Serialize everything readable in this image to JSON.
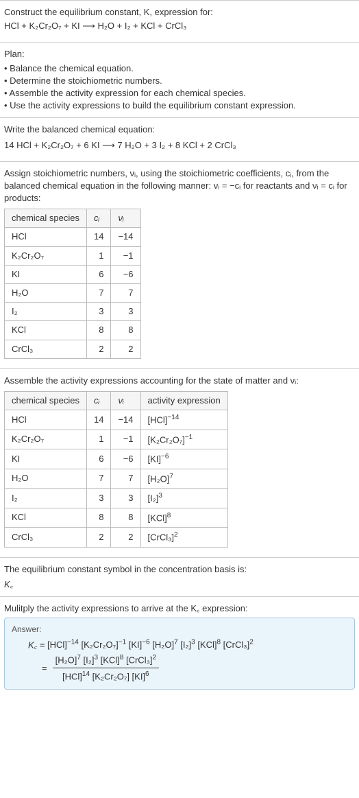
{
  "intro": {
    "line1": "Construct the equilibrium constant, K, expression for:",
    "equation": "HCl + K₂Cr₂O₇ + KI ⟶ H₂O + I₂ + KCl + CrCl₃"
  },
  "plan": {
    "header": "Plan:",
    "items": [
      "• Balance the chemical equation.",
      "• Determine the stoichiometric numbers.",
      "• Assemble the activity expression for each chemical species.",
      "• Use the activity expressions to build the equilibrium constant expression."
    ]
  },
  "balanced": {
    "label": "Write the balanced chemical equation:",
    "equation": "14 HCl + K₂Cr₂O₇ + 6 KI ⟶ 7 H₂O + 3 I₂ + 8 KCl + 2 CrCl₃"
  },
  "stoich": {
    "text": "Assign stoichiometric numbers, νᵢ, using the stoichiometric coefficients, cᵢ, from the balanced chemical equation in the following manner: νᵢ = −cᵢ for reactants and νᵢ = cᵢ for products:",
    "headers": [
      "chemical species",
      "cᵢ",
      "νᵢ"
    ],
    "rows": [
      {
        "sp": "HCl",
        "c": "14",
        "n": "−14"
      },
      {
        "sp": "K₂Cr₂O₇",
        "c": "1",
        "n": "−1"
      },
      {
        "sp": "KI",
        "c": "6",
        "n": "−6"
      },
      {
        "sp": "H₂O",
        "c": "7",
        "n": "7"
      },
      {
        "sp": "I₂",
        "c": "3",
        "n": "3"
      },
      {
        "sp": "KCl",
        "c": "8",
        "n": "8"
      },
      {
        "sp": "CrCl₃",
        "c": "2",
        "n": "2"
      }
    ]
  },
  "activity": {
    "text": "Assemble the activity expressions accounting for the state of matter and νᵢ:",
    "headers": [
      "chemical species",
      "cᵢ",
      "νᵢ",
      "activity expression"
    ],
    "rows": [
      {
        "sp": "HCl",
        "c": "14",
        "n": "−14",
        "a_base": "[HCl]",
        "a_exp": "−14"
      },
      {
        "sp": "K₂Cr₂O₇",
        "c": "1",
        "n": "−1",
        "a_base": "[K₂Cr₂O₇]",
        "a_exp": "−1"
      },
      {
        "sp": "KI",
        "c": "6",
        "n": "−6",
        "a_base": "[KI]",
        "a_exp": "−6"
      },
      {
        "sp": "H₂O",
        "c": "7",
        "n": "7",
        "a_base": "[H₂O]",
        "a_exp": "7"
      },
      {
        "sp": "I₂",
        "c": "3",
        "n": "3",
        "a_base": "[I₂]",
        "a_exp": "3"
      },
      {
        "sp": "KCl",
        "c": "8",
        "n": "8",
        "a_base": "[KCl]",
        "a_exp": "8"
      },
      {
        "sp": "CrCl₃",
        "c": "2",
        "n": "2",
        "a_base": "[CrCl₃]",
        "a_exp": "2"
      }
    ]
  },
  "conc_basis": {
    "text": "The equilibrium constant symbol in the concentration basis is:",
    "symbol": "K꜀"
  },
  "multiply": {
    "text": "Mulitply the activity expressions to arrive at the K꜀ expression:"
  },
  "answer": {
    "label": "Answer:",
    "kc_prefix": "K꜀ = ",
    "eq_sign": "= ",
    "line1": [
      {
        "b": "[HCl]",
        "e": "−14"
      },
      {
        "b": " [K₂Cr₂O₇]",
        "e": "−1"
      },
      {
        "b": " [KI]",
        "e": "−6"
      },
      {
        "b": " [H₂O]",
        "e": "7"
      },
      {
        "b": " [I₂]",
        "e": "3"
      },
      {
        "b": " [KCl]",
        "e": "8"
      },
      {
        "b": " [CrCl₃]",
        "e": "2"
      }
    ],
    "frac_num": [
      {
        "b": "[H₂O]",
        "e": "7"
      },
      {
        "b": " [I₂]",
        "e": "3"
      },
      {
        "b": " [KCl]",
        "e": "8"
      },
      {
        "b": " [CrCl₃]",
        "e": "2"
      }
    ],
    "frac_den": [
      {
        "b": "[HCl]",
        "e": "14"
      },
      {
        "b": " [K₂Cr₂O₇]",
        "e": ""
      },
      {
        "b": " [KI]",
        "e": "6"
      }
    ]
  }
}
